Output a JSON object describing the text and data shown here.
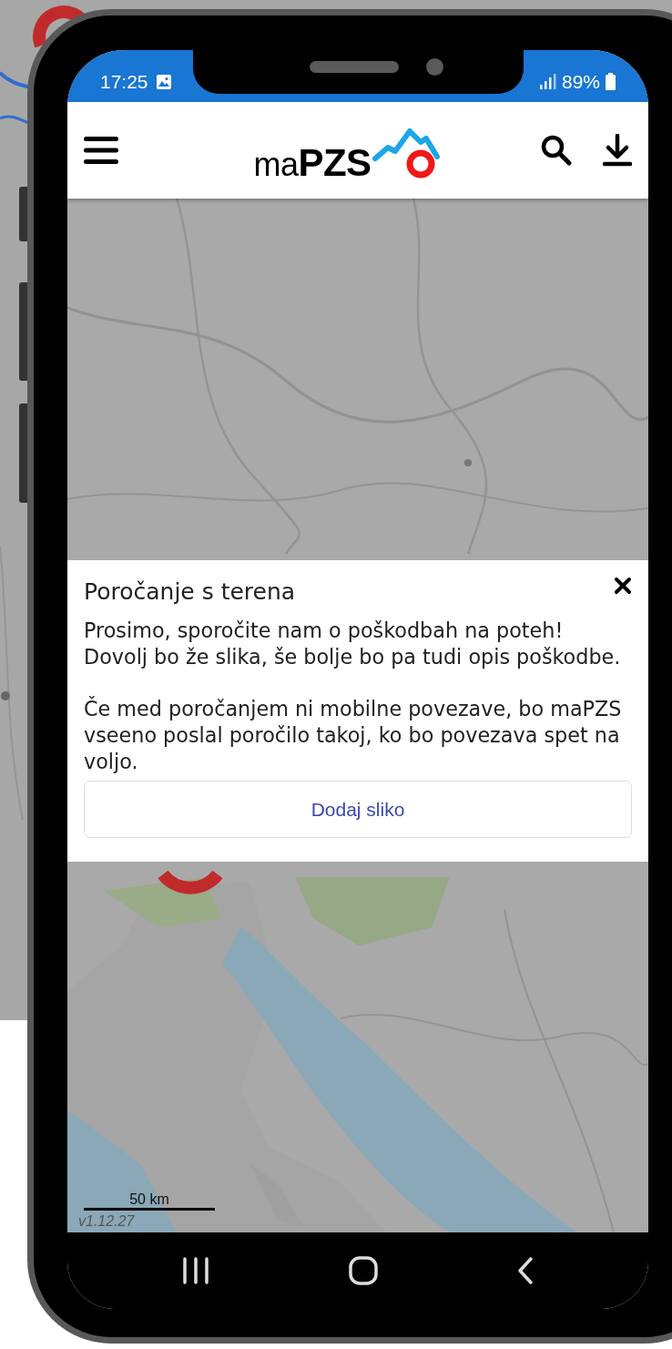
{
  "status_bar": {
    "time": "17:25",
    "battery": "89%"
  },
  "header": {
    "logo": "ma**PZS**"
  },
  "map": {
    "scale": "50 km",
    "version": "v1.12.27"
  },
  "dialog": {
    "title": "Poročanje s terena",
    "paragraphs": [
      "Prosimo, sporočite nam o poškodbah na poteh! Dovolj bo že slika, še bolje bo pa tudi opis poškodbe.",
      "Če med poročanjem ni mobilne povezave, bo maPZS vseeno poslal poročilo takoj, ko bo povezava spet na voljo."
    ],
    "button": "Dodaj sliko"
  }
}
